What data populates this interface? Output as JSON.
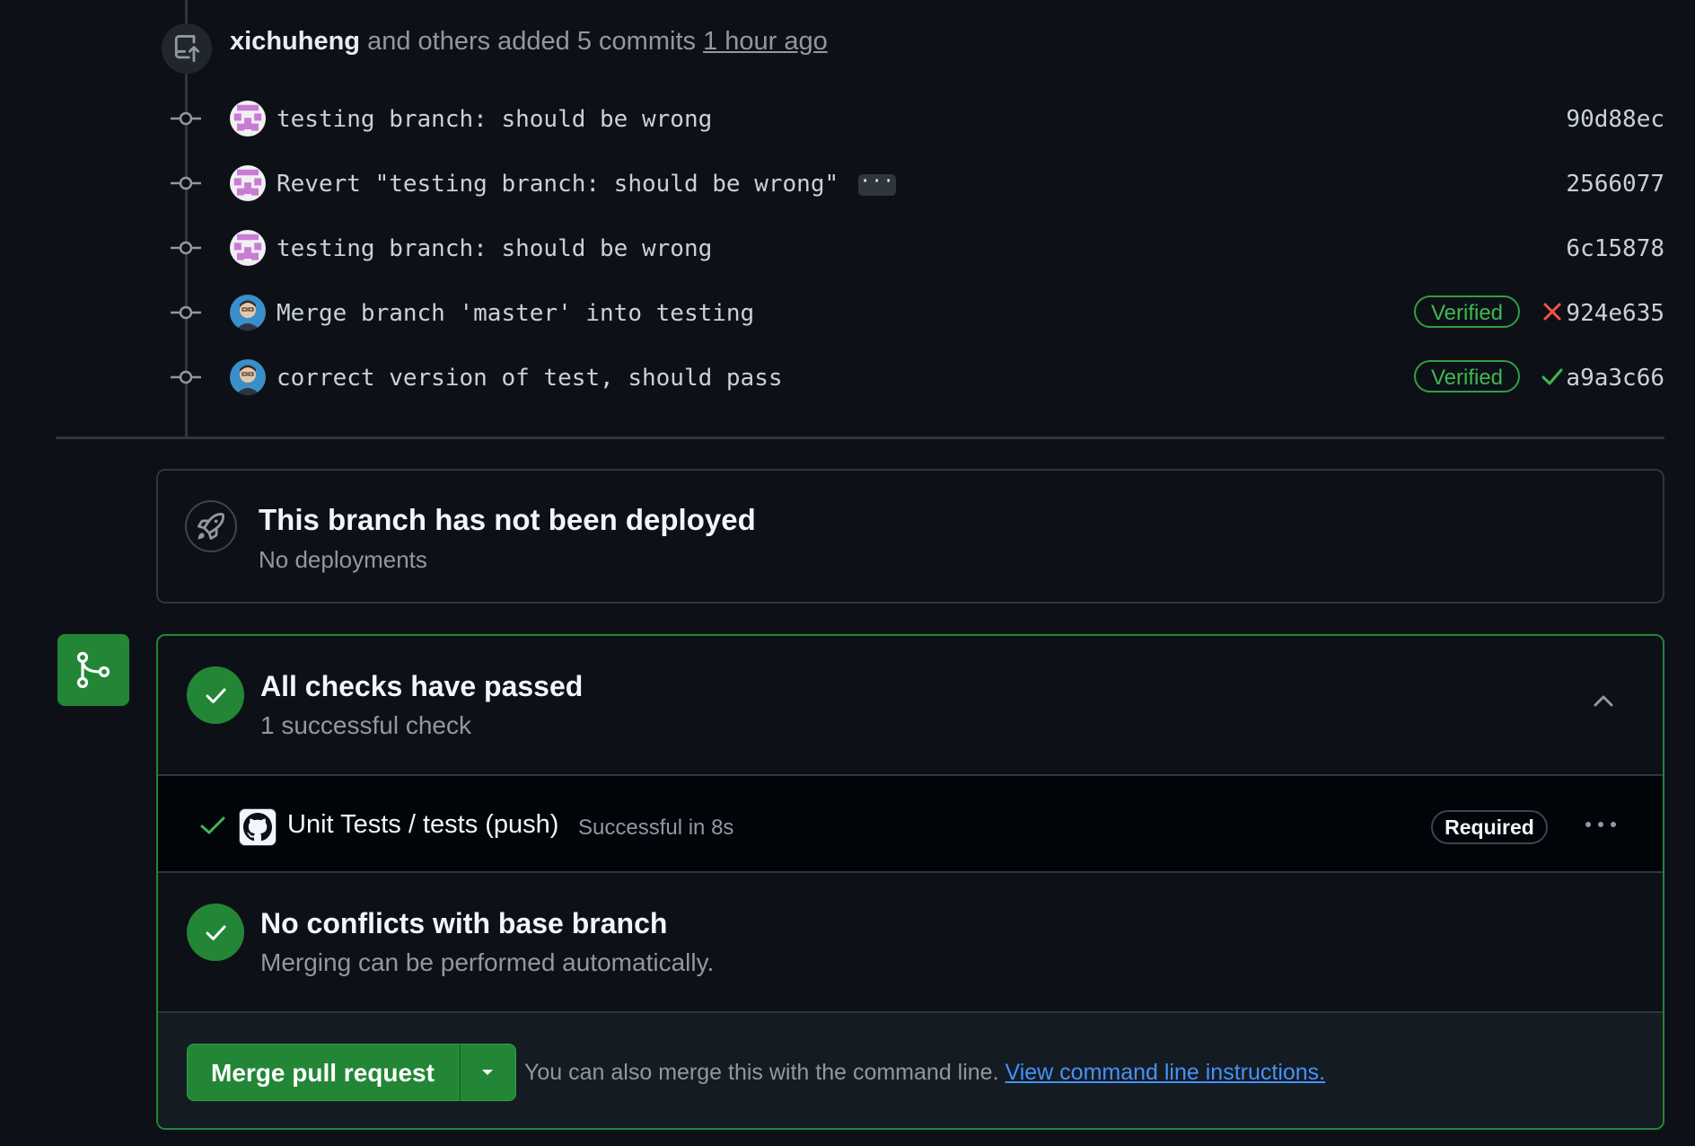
{
  "push": {
    "author": "xichuheng",
    "action_text": " and others added 5 commits ",
    "time": "1 hour ago"
  },
  "commits": [
    {
      "message": "testing branch: should be wrong",
      "sha": "90d88ec",
      "verified": false,
      "status": "none",
      "avatar": "identicon"
    },
    {
      "message": "Revert \"testing branch: should be wrong\"",
      "sha": "2566077",
      "verified": false,
      "status": "none",
      "avatar": "identicon",
      "ellipsis": "···"
    },
    {
      "message": "testing branch: should be wrong",
      "sha": "6c15878",
      "verified": false,
      "status": "none",
      "avatar": "identicon"
    },
    {
      "message": "Merge branch 'master' into testing",
      "sha": "924e635",
      "verified": true,
      "verified_label": "Verified",
      "status": "failure",
      "avatar": "photo"
    },
    {
      "message": "correct version of test, should pass",
      "sha": "a9a3c66",
      "verified": true,
      "verified_label": "Verified",
      "status": "success",
      "avatar": "photo"
    }
  ],
  "deployment": {
    "title": "This branch has not been deployed",
    "subtitle": "No deployments",
    "icon": "rocket-icon"
  },
  "checks": {
    "title": "All checks have passed",
    "subtitle": "1 successful check",
    "runs": [
      {
        "name": "Unit Tests / tests (push)",
        "status": "Successful in 8s",
        "badge": "Required",
        "icon": "github-logo-icon"
      }
    ]
  },
  "conflicts": {
    "title": "No conflicts with base branch",
    "subtitle": "Merging can be performed automatically."
  },
  "merge": {
    "button_label": "Merge pull request",
    "hint": "You can also merge this with the command line. ",
    "link": "View command line instructions."
  },
  "colors": {
    "background": "#0d1117",
    "success": "#238636",
    "success_text": "#3fb950",
    "failure": "#f85149",
    "link": "#4493f8"
  }
}
